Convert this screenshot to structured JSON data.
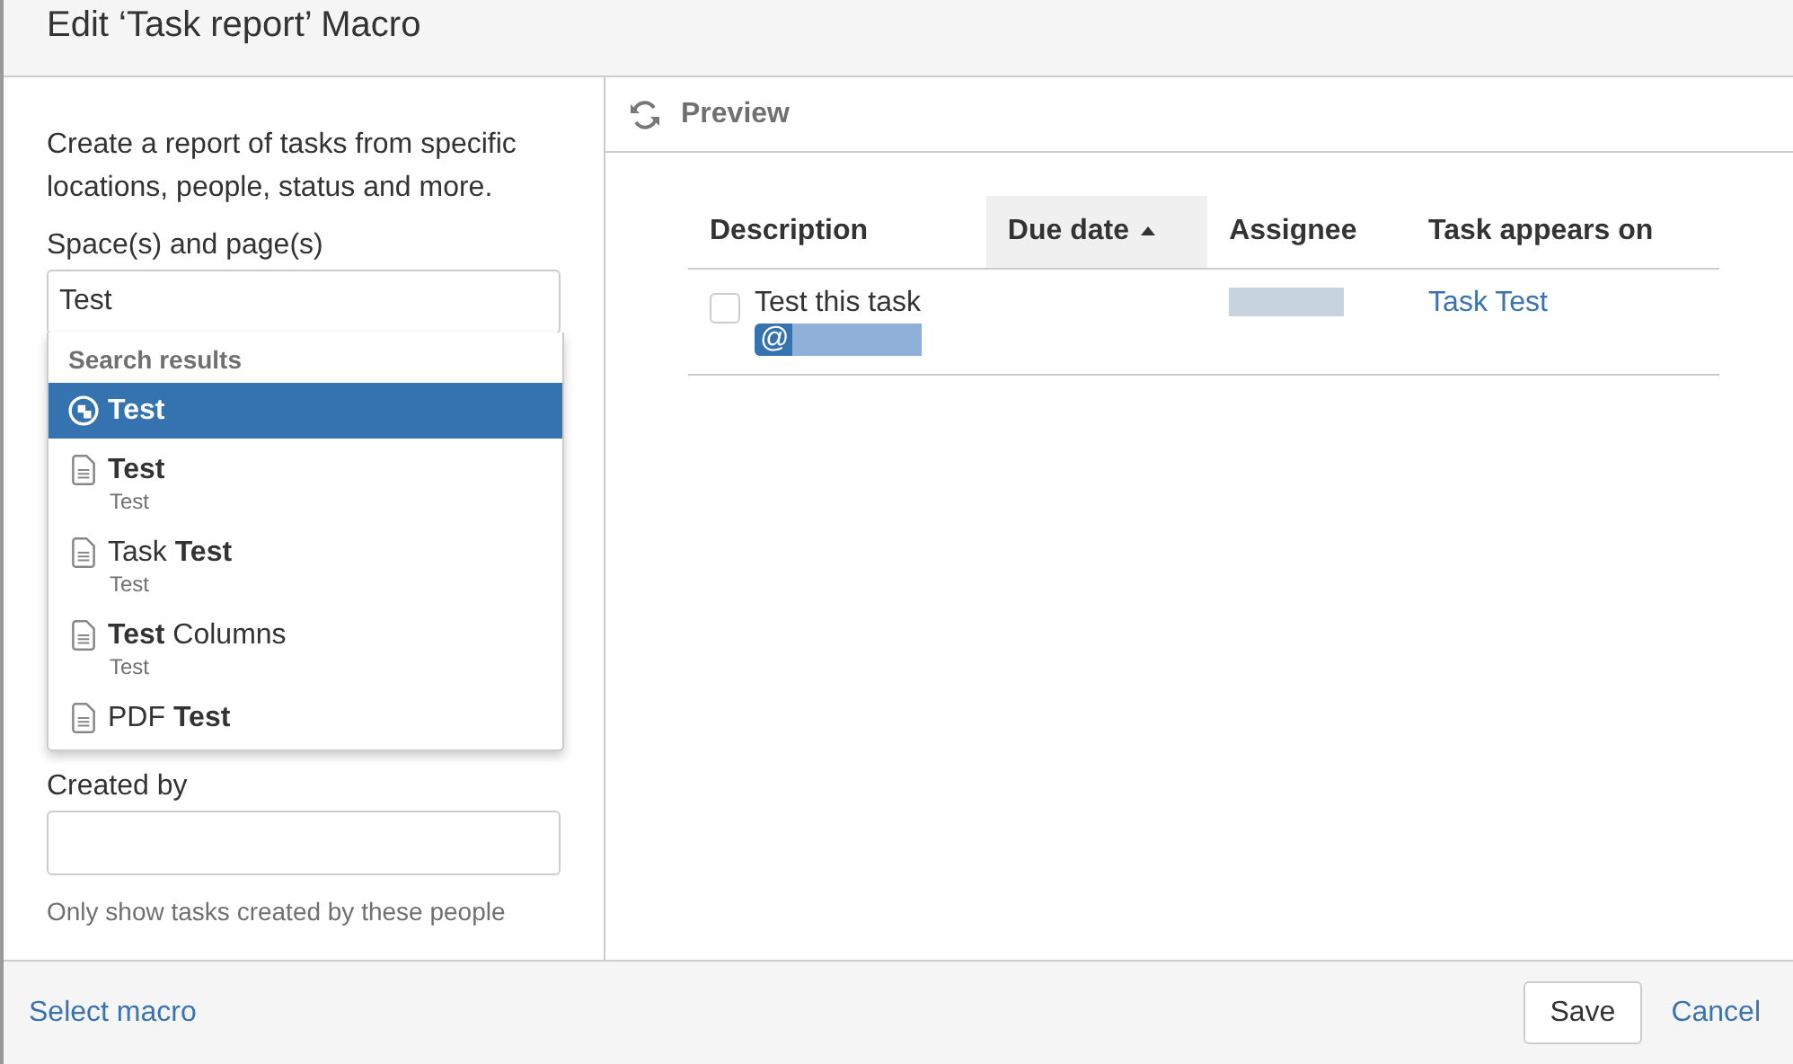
{
  "dialog": {
    "title": "Edit ‘Task report’ Macro"
  },
  "form": {
    "description": "Create a report of tasks from specific locations, people, status and more.",
    "spaces_label": "Space(s) and page(s)",
    "spaces_value": "Test",
    "search_results": {
      "heading": "Search results",
      "items": [
        {
          "kind": "space",
          "title": "Test",
          "selected": true
        },
        {
          "kind": "page",
          "title": "**Test**",
          "space": "Test",
          "selected": false
        },
        {
          "kind": "page",
          "title": "Task **Test**",
          "space": "Test",
          "selected": false
        },
        {
          "kind": "page",
          "title": "**Test** Columns",
          "space": "Test",
          "selected": false
        },
        {
          "kind": "page",
          "title": "PDF **Test**",
          "selected": false
        }
      ]
    },
    "created_by_label": "Created by",
    "created_by_help": "Only show tasks created by these people"
  },
  "preview": {
    "title": "Preview",
    "columns": [
      {
        "label": "Description",
        "sorted": false
      },
      {
        "label": "Due date",
        "sorted": true
      },
      {
        "label": "Assignee",
        "sorted": false
      },
      {
        "label": "Task appears on",
        "sorted": false
      }
    ],
    "rows": [
      {
        "checked": false,
        "description": "Test this task",
        "mention": "@",
        "page": "Task Test"
      }
    ]
  },
  "footer": {
    "select_macro": "Select macro",
    "save": "Save",
    "cancel": "Cancel"
  }
}
